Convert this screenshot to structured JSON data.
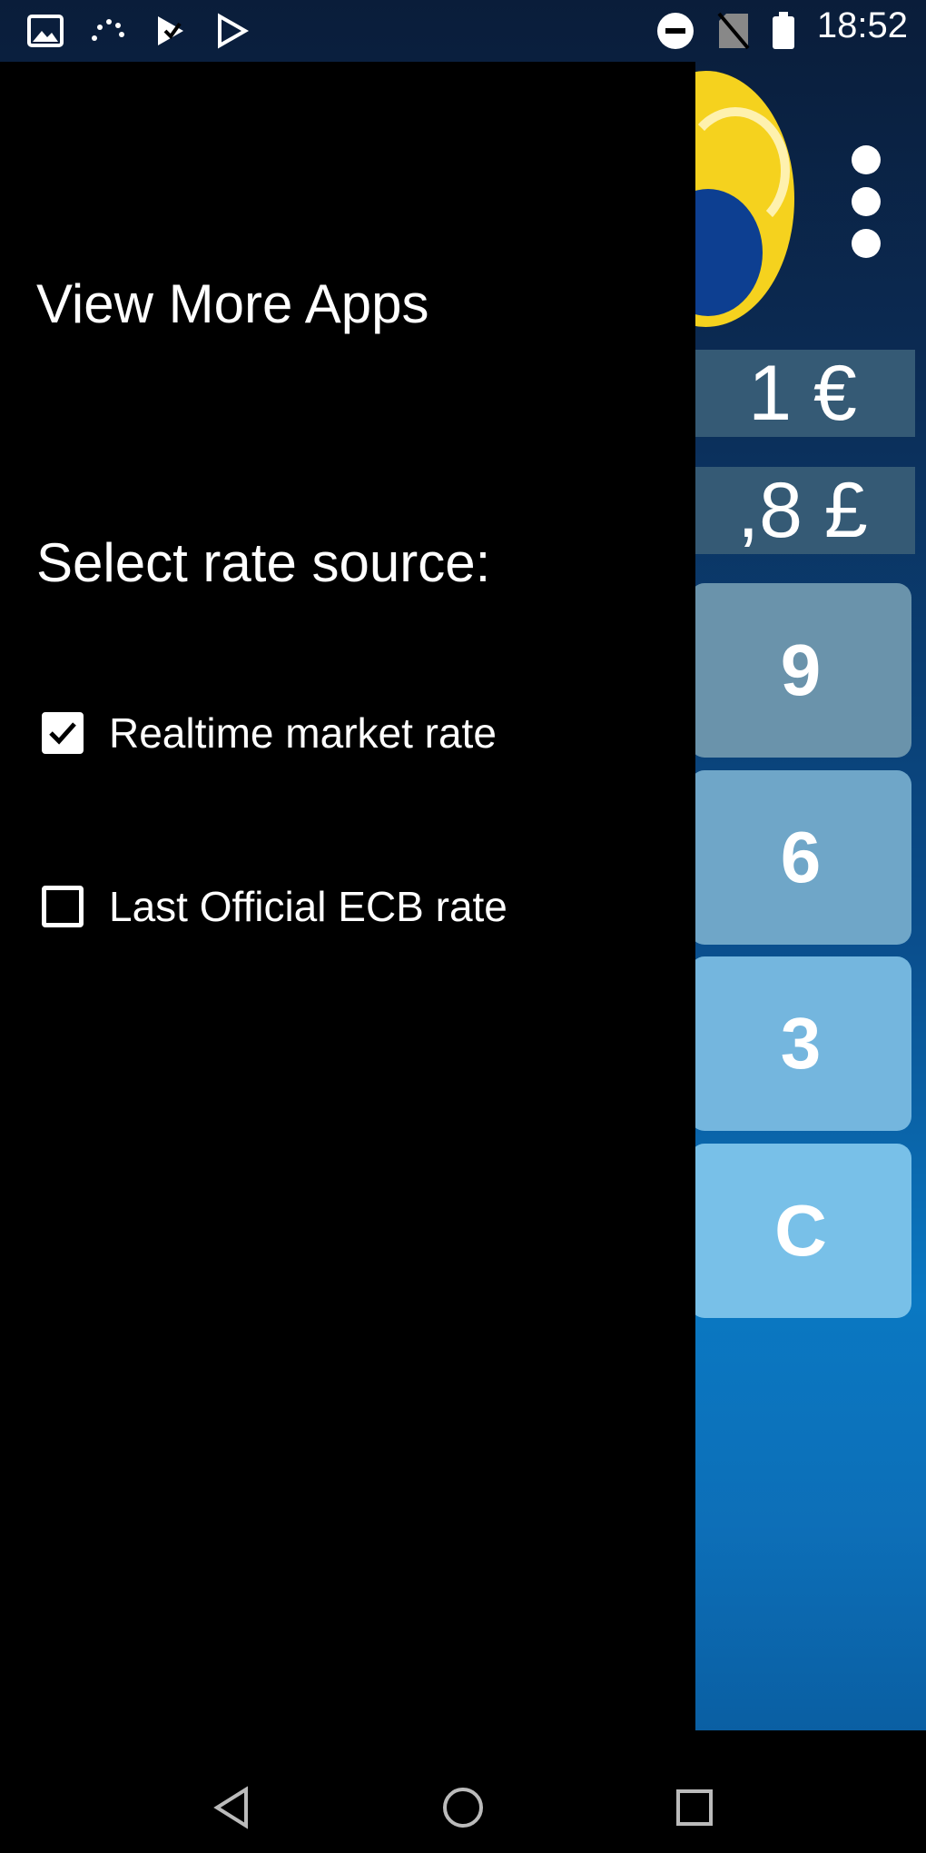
{
  "status_bar": {
    "time": "18:52",
    "icons": [
      "image-icon",
      "loading-icon",
      "play-store-check-icon",
      "play-store-icon",
      "do-not-disturb-icon",
      "no-sim-icon",
      "battery-icon"
    ]
  },
  "app": {
    "amount_value": "1 €",
    "converted_value": ",8 £",
    "keypad": [
      "9",
      "6",
      "3",
      "C"
    ]
  },
  "drawer": {
    "view_more_apps": "View More Apps",
    "select_rate_title": "Select rate source:",
    "options": [
      {
        "label": "Realtime market rate",
        "checked": true
      },
      {
        "label": "Last Official ECB rate",
        "checked": false
      }
    ]
  },
  "colors": {
    "drawer_bg": "#000000",
    "value_field_bg": "#355a75",
    "logo_yellow": "#f5d21e",
    "logo_blue": "#0d3f91"
  }
}
